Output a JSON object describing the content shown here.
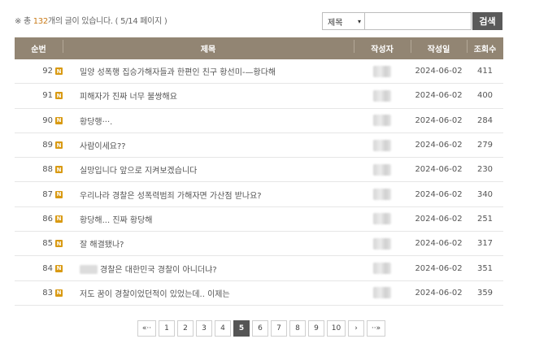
{
  "summary": {
    "prefix": "※ 총",
    "count": "132",
    "suffix": "개의 글이 있습니다. ( 5/14 페이지 )"
  },
  "search": {
    "field_value": "제목",
    "field_arrow": "▾",
    "query": "",
    "button_label": "검색"
  },
  "table": {
    "headers": {
      "no": "순번",
      "title": "제목",
      "writer": "작성자",
      "date": "작성일",
      "views": "조회수"
    },
    "new_badge": "N",
    "rows": [
      {
        "no": "92",
        "title": "밀양 성폭행 집승가해자들과 한편인 친구 황선미-—황다해",
        "date": "2024-06-02",
        "views": "411"
      },
      {
        "no": "91",
        "title": "피해자가 진짜 너무 불쌍해요",
        "date": "2024-06-02",
        "views": "400"
      },
      {
        "no": "90",
        "title": "황당행···.",
        "date": "2024-06-02",
        "views": "284"
      },
      {
        "no": "89",
        "title": "사람이세요??",
        "date": "2024-06-02",
        "views": "279"
      },
      {
        "no": "88",
        "title": "실망입니다 앞으로 지켜보겠습니다",
        "date": "2024-06-02",
        "views": "230"
      },
      {
        "no": "87",
        "title": "우리나라 경찰은 성폭력범죄 가해자면 가산점 받나요?",
        "date": "2024-06-02",
        "views": "340"
      },
      {
        "no": "86",
        "title": "황당해... 진짜 황당해",
        "date": "2024-06-02",
        "views": "251"
      },
      {
        "no": "85",
        "title": "잘 해결됐나?",
        "date": "2024-06-02",
        "views": "317"
      },
      {
        "no": "84",
        "title": "경찰은 대한민국 경찰이 아니더냐?",
        "date": "2024-06-02",
        "views": "351"
      },
      {
        "no": "83",
        "title": "저도 꿈이 경찰이었던적이 있었는데.. 이제는",
        "date": "2024-06-02",
        "views": "359"
      }
    ]
  },
  "pager": {
    "first": "«··",
    "prev": "›",
    "pages": [
      "1",
      "2",
      "3",
      "4",
      "5",
      "6",
      "7",
      "8",
      "9",
      "10"
    ],
    "current": "5",
    "next": "›",
    "last": "··»"
  }
}
